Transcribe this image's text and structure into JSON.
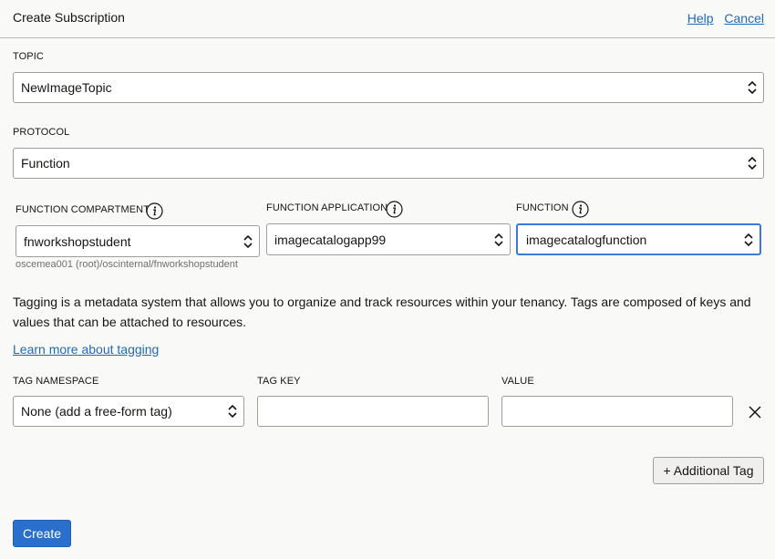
{
  "header": {
    "title": "Create Subscription",
    "help_label": "Help",
    "cancel_label": "Cancel"
  },
  "topic": {
    "label": "TOPIC",
    "value": "NewImageTopic"
  },
  "protocol": {
    "label": "PROTOCOL",
    "value": "Function"
  },
  "function_compartment": {
    "label": "FUNCTION COMPARTMENT",
    "value": "fnworkshopstudent",
    "path_hint": "oscemea001 (root)/oscinternal/fnworkshopstudent"
  },
  "function_application": {
    "label": "FUNCTION APPLICATION",
    "value": "imagecatalogapp99"
  },
  "function": {
    "label": "FUNCTION",
    "value": "imagecatalogfunction"
  },
  "tagging": {
    "description": "Tagging is a metadata system that allows you to organize and track resources within your tenancy. Tags are composed of keys and values that can be attached to resources.",
    "learn_more": "Learn more about tagging",
    "namespace_label": "TAG NAMESPACE",
    "namespace_value": "None (add a free-form tag)",
    "key_label": "TAG KEY",
    "key_value": "",
    "value_label": "VALUE",
    "value_value": "",
    "additional_tag_label": "+ Additional Tag"
  },
  "footer": {
    "create_label": "Create"
  },
  "colors": {
    "accent": "#2a6fcb",
    "link": "#1e6bb8",
    "focus": "#3a7bd5",
    "background": "#f9f9f8"
  },
  "icons": [
    "info-icon",
    "chevron-updown-icon",
    "close-icon"
  ]
}
